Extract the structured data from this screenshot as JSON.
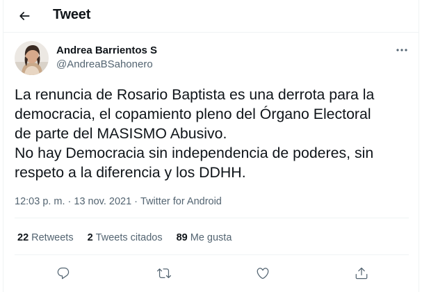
{
  "header": {
    "title": "Tweet"
  },
  "author": {
    "name": "Andrea Barrientos S",
    "handle": "@AndreaBSahonero"
  },
  "tweet": {
    "lines": [
      "La renuncia de Rosario Baptista es una derrota para la",
      "democracia, el copamiento pleno del Órgano Electoral",
      "de parte del MASISMO Abusivo.",
      "No hay Democracia sin independencia de poderes, sin",
      "respeto a la diferencia y los DDHH."
    ]
  },
  "meta": {
    "time": "12:03 p. m.",
    "dot1": "·",
    "date": "13 nov. 2021",
    "dot2": "·",
    "source": "Twitter for Android"
  },
  "stats": {
    "retweets": {
      "count": "22",
      "label": "Retweets"
    },
    "quotes": {
      "count": "2",
      "label": "Tweets citados"
    },
    "likes": {
      "count": "89",
      "label": "Me gusta"
    }
  },
  "icons": {
    "back": "arrow-left-icon",
    "more": "more-horizontal-icon",
    "reply": "reply-icon",
    "retweet": "retweet-icon",
    "like": "heart-icon",
    "share": "share-icon"
  },
  "colors": {
    "text": "#0f1419",
    "secondary": "#536471",
    "border": "#eff3f4",
    "icon": "#536471"
  }
}
